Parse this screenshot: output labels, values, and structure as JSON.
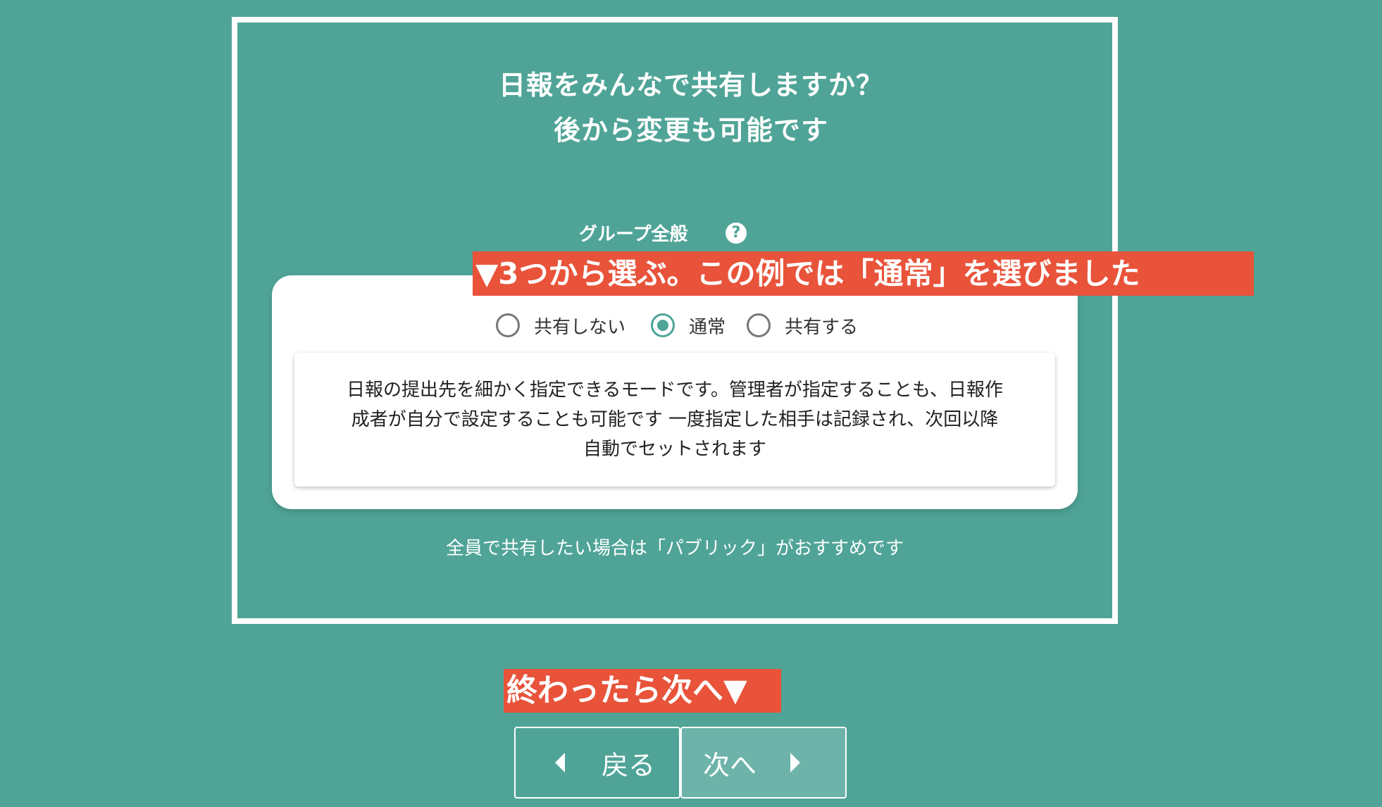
{
  "heading": {
    "line1": "日報をみんなで共有しますか？",
    "line2": "後から変更も可能です"
  },
  "scope": {
    "label": "グループ全般",
    "help_icon": "?"
  },
  "sharing_options": [
    {
      "label": "共有しない",
      "selected": false
    },
    {
      "label": "通常",
      "selected": true
    },
    {
      "label": "共有する",
      "selected": false
    }
  ],
  "description": {
    "line1": "日報の提出先を細かく指定できるモードです。管理者が指定することも、日報作",
    "line2": "成者が自分で設定することも可能です 一度指定した相手は記録され、次回以降",
    "line3": "自動でセットされます"
  },
  "recommendation": "全員で共有したい場合は「パブリック」がおすすめです",
  "annotations": {
    "top": "▼3つから選ぶ。この例では「通常」を選びました",
    "bottom": "終わったら次へ▼"
  },
  "navigation": {
    "back_label": "戻る",
    "next_label": "次へ"
  },
  "colors": {
    "background": "#4fa497",
    "accent": "#4fa497",
    "annotation": "#e8533a",
    "next_button": "#6db3a9"
  }
}
